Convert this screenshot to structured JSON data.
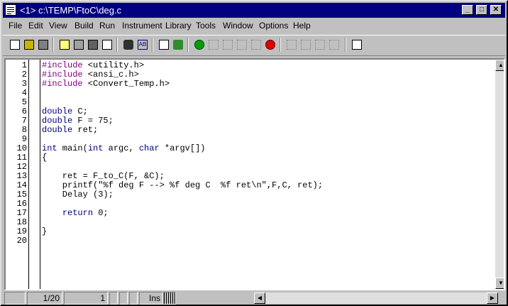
{
  "window": {
    "title": "<1> c:\\TEMP\\FtoC\\deg.c"
  },
  "title_buttons": [
    {
      "name": "minimize-button",
      "glyph": "_"
    },
    {
      "name": "maximize-button",
      "glyph": "□"
    },
    {
      "name": "close-button",
      "glyph": "✕"
    }
  ],
  "menu": [
    {
      "label": "File"
    },
    {
      "label": "Edit"
    },
    {
      "label": "View"
    },
    {
      "label": "Build"
    },
    {
      "label": "Run"
    },
    {
      "label": "Instrument"
    },
    {
      "label": "Library"
    },
    {
      "label": "Tools"
    },
    {
      "label": "Window"
    },
    {
      "label": "Options"
    },
    {
      "label": "Help"
    }
  ],
  "toolbar": [
    {
      "icon": "new-file-icon"
    },
    {
      "icon": "open-folder-icon"
    },
    {
      "icon": "save-icon"
    },
    {
      "icon": "include-file-icon"
    },
    {
      "icon": "project-icon"
    },
    {
      "icon": "target-icon"
    },
    {
      "icon": "uir-editor-icon"
    },
    {
      "icon": "find-binoculars-icon"
    },
    {
      "icon": "find-replace-icon"
    },
    {
      "icon": "compile-icon"
    },
    {
      "icon": "run-icon"
    },
    {
      "icon": "go-icon"
    },
    {
      "icon": "step-over-icon"
    },
    {
      "icon": "step-into-icon"
    },
    {
      "icon": "finish-function-icon"
    },
    {
      "icon": "trace-icon"
    },
    {
      "icon": "stop-icon"
    },
    {
      "icon": "breakpoint-icon"
    },
    {
      "icon": "watch-icon"
    },
    {
      "icon": "variables-icon"
    },
    {
      "icon": "memory-icon"
    },
    {
      "icon": "function-panel-icon"
    }
  ],
  "code": {
    "line_numbers": [
      "1",
      "2",
      "3",
      "4",
      "5",
      "6",
      "7",
      "8",
      "9",
      "10",
      "11",
      "12",
      "13",
      "14",
      "15",
      "16",
      "17",
      "18",
      "19",
      "20"
    ],
    "lines": [
      [
        {
          "t": "#include",
          "c": "pp"
        },
        {
          "t": " <utility.h>",
          "c": "n"
        }
      ],
      [
        {
          "t": "#include",
          "c": "pp"
        },
        {
          "t": " <ansi_c.h>",
          "c": "n"
        }
      ],
      [
        {
          "t": "#include",
          "c": "pp"
        },
        {
          "t": " <Convert_Temp.h>",
          "c": "n"
        }
      ],
      [],
      [],
      [
        {
          "t": "double",
          "c": "kw"
        },
        {
          "t": " C;",
          "c": "n"
        }
      ],
      [
        {
          "t": "double",
          "c": "kw"
        },
        {
          "t": " F = 75;",
          "c": "n"
        }
      ],
      [
        {
          "t": "double",
          "c": "kw"
        },
        {
          "t": " ret;",
          "c": "n"
        }
      ],
      [],
      [
        {
          "t": "int",
          "c": "kw"
        },
        {
          "t": " main(",
          "c": "n"
        },
        {
          "t": "int",
          "c": "kw"
        },
        {
          "t": " argc, ",
          "c": "n"
        },
        {
          "t": "char",
          "c": "kw"
        },
        {
          "t": " *argv[])",
          "c": "n"
        }
      ],
      [
        {
          "t": "{",
          "c": "n"
        }
      ],
      [],
      [
        {
          "t": "    ret = F_to_C(F, &C);",
          "c": "n"
        }
      ],
      [
        {
          "t": "    printf(\"%f deg F --> %f deg C  %f ret\\n\",F,C, ret);",
          "c": "n"
        }
      ],
      [
        {
          "t": "    Delay (3);",
          "c": "n"
        }
      ],
      [],
      [
        {
          "t": "    ",
          "c": "n"
        },
        {
          "t": "return",
          "c": "kw"
        },
        {
          "t": " 0;",
          "c": "n"
        }
      ],
      [],
      [
        {
          "t": "}",
          "c": "n"
        }
      ],
      []
    ]
  },
  "colors": {
    "kw": "#000080",
    "pp": "#800080",
    "n": "#000000",
    "titlebar": "#000080"
  },
  "status": {
    "line_position": "1/20",
    "column": "1",
    "mode": "Ins"
  }
}
